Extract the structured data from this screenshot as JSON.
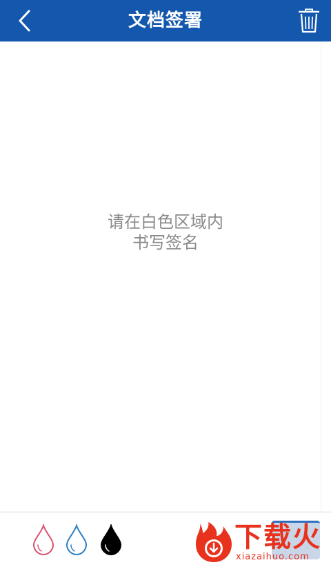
{
  "header": {
    "title": "文档签署",
    "back_icon": "chevron-left-icon",
    "delete_icon": "trash-icon",
    "background": "#1358ad"
  },
  "canvas": {
    "hint_line1": "请在白色区域内",
    "hint_line2": "书写签名"
  },
  "toolbar": {
    "pens": [
      {
        "icon": "ink-drop-icon",
        "color": "#d9536d",
        "selected": false
      },
      {
        "icon": "ink-drop-icon",
        "color": "#2b7fc2",
        "selected": false
      },
      {
        "icon": "ink-drop-icon",
        "color": "#000000",
        "selected": true
      }
    ]
  },
  "watermark": {
    "brand": "下载火",
    "domain": "xiazaihuo.com",
    "color": "#e8321d"
  }
}
